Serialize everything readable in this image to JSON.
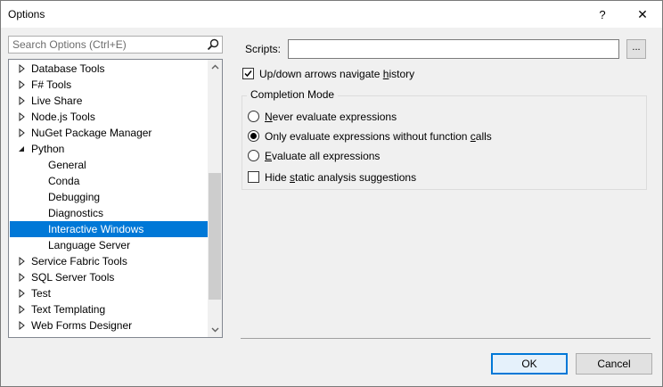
{
  "window": {
    "title": "Options",
    "help_label": "?",
    "close_label": "✕"
  },
  "search": {
    "placeholder": "Search Options (Ctrl+E)",
    "icon": "search-icon"
  },
  "tree": {
    "items": [
      {
        "label": "Database Tools",
        "expander": "collapsed",
        "level": 0
      },
      {
        "label": "F# Tools",
        "expander": "collapsed",
        "level": 0
      },
      {
        "label": "Live Share",
        "expander": "collapsed",
        "level": 0
      },
      {
        "label": "Node.js Tools",
        "expander": "collapsed",
        "level": 0
      },
      {
        "label": "NuGet Package Manager",
        "expander": "collapsed",
        "level": 0
      },
      {
        "label": "Python",
        "expander": "expanded",
        "level": 0
      },
      {
        "label": "General",
        "expander": "none",
        "level": 1
      },
      {
        "label": "Conda",
        "expander": "none",
        "level": 1
      },
      {
        "label": "Debugging",
        "expander": "none",
        "level": 1
      },
      {
        "label": "Diagnostics",
        "expander": "none",
        "level": 1
      },
      {
        "label": "Interactive Windows",
        "expander": "none",
        "level": 1,
        "selected": true
      },
      {
        "label": "Language Server",
        "expander": "none",
        "level": 1
      },
      {
        "label": "Service Fabric Tools",
        "expander": "collapsed",
        "level": 0
      },
      {
        "label": "SQL Server Tools",
        "expander": "collapsed",
        "level": 0
      },
      {
        "label": "Test",
        "expander": "collapsed",
        "level": 0
      },
      {
        "label": "Text Templating",
        "expander": "collapsed",
        "level": 0
      },
      {
        "label": "Web Forms Designer",
        "expander": "collapsed",
        "level": 0
      }
    ],
    "scroll_position": 0.55,
    "selected_color": "#0078d7"
  },
  "settings": {
    "scripts_label": "Scripts:",
    "scripts_value": "",
    "browse_label": "...",
    "updown": {
      "text_before": "Up/down arrows navigate ",
      "accel": "h",
      "text_after": "istory",
      "checked": true
    },
    "completion_mode": {
      "title": "Completion Mode",
      "never": {
        "accel": "N",
        "rest": "ever evaluate expressions",
        "checked": false
      },
      "only": {
        "text_before": "Only evaluate expressions without function ",
        "accel": "c",
        "text_after": "alls",
        "checked": true
      },
      "all": {
        "accel": "E",
        "rest": "valuate all expressions",
        "checked": false
      },
      "hide": {
        "text_before": "Hide ",
        "accel": "s",
        "text_after": "tatic analysis suggestions",
        "checked": false
      }
    }
  },
  "buttons": {
    "ok_label": "OK",
    "cancel_label": "Cancel"
  }
}
